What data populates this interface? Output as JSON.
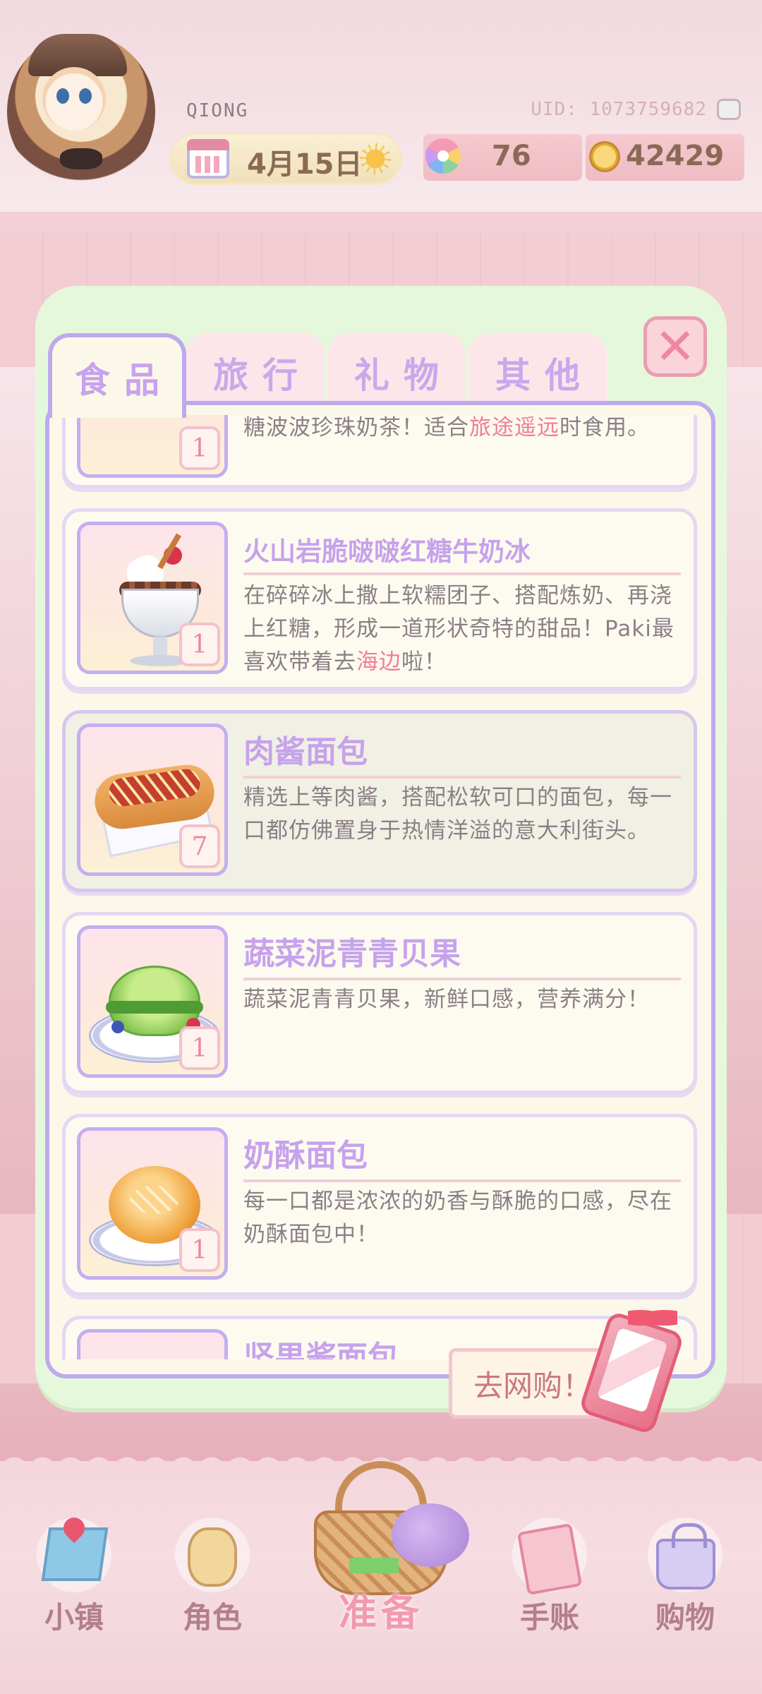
{
  "header": {
    "username": "QIONG",
    "uid": "UID: 1073759682",
    "date": "4月15日",
    "flowers": "76",
    "coins": "42429"
  },
  "tabs": [
    {
      "label": "食品",
      "active": true
    },
    {
      "label": "旅行",
      "active": false
    },
    {
      "label": "礼物",
      "active": false
    },
    {
      "label": "其他",
      "active": false
    }
  ],
  "items": [
    {
      "title": "",
      "desc_pre": "糖波波珍珠奶茶！适合",
      "desc_hl": "旅途遥远",
      "desc_post": "时食用。",
      "qty": "1"
    },
    {
      "title": "火山岩脆啵啵红糖牛奶冰",
      "desc_pre": "在碎碎冰上撒上软糯团子、搭配炼奶、再浇上红糖，形成一道形状奇特的甜品！Paki最喜欢带着去",
      "desc_hl": "海边",
      "desc_post": "啦！",
      "qty": "1"
    },
    {
      "title": "肉酱面包",
      "desc_pre": "精选上等肉酱，搭配松软可口的面包，每一口都仿佛置身于热情洋溢的意大利街头。",
      "desc_hl": "",
      "desc_post": "",
      "qty": "7"
    },
    {
      "title": "蔬菜泥青青贝果",
      "desc_pre": "蔬菜泥青青贝果，新鲜口感，营养满分！",
      "desc_hl": "",
      "desc_post": "",
      "qty": "1"
    },
    {
      "title": "奶酥面包",
      "desc_pre": "每一口都是浓浓的奶香与酥脆的口感，尽在奶酥面包中！",
      "desc_hl": "",
      "desc_post": "",
      "qty": "1"
    },
    {
      "title": "坚果酱面包",
      "desc_pre": "",
      "desc_hl": "",
      "desc_post": "",
      "qty": ""
    }
  ],
  "shop_button": "去网购！",
  "nav": {
    "town": "小镇",
    "character": "角色",
    "prepare": "准备",
    "journal": "手账",
    "shopping": "购物"
  },
  "icons": {
    "calendar": "calendar-icon",
    "weather": "sun-icon",
    "flower": "flower-currency-icon",
    "coin": "coin-icon",
    "close": "close-icon",
    "copy": "copy-icon"
  },
  "colors": {
    "accent_purple": "#c7a2ec",
    "highlight_pink": "#f17d98",
    "panel_green": "#e6f8dc",
    "panel_cream": "#fbf8e9"
  }
}
